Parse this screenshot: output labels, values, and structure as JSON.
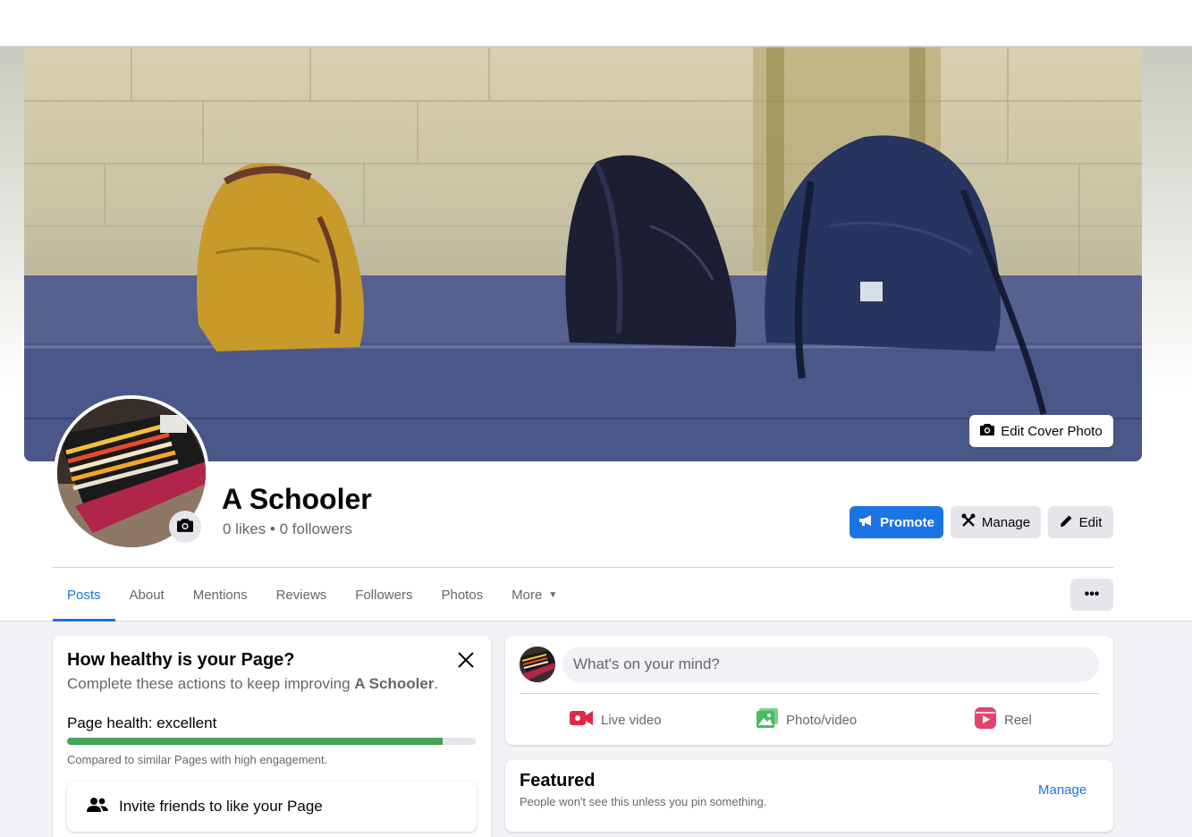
{
  "cover": {
    "edit_label": "Edit Cover Photo"
  },
  "page": {
    "name": "A Schooler",
    "stats": "0 likes • 0 followers"
  },
  "actions": {
    "promote": "Promote",
    "manage": "Manage",
    "edit": "Edit"
  },
  "tabs": [
    {
      "label": "Posts",
      "active": true
    },
    {
      "label": "About"
    },
    {
      "label": "Mentions"
    },
    {
      "label": "Reviews"
    },
    {
      "label": "Followers"
    },
    {
      "label": "Photos"
    },
    {
      "label": "More"
    }
  ],
  "more_options_label": "•••",
  "health": {
    "title": "How healthy is your Page?",
    "subtitle_prefix": "Complete these actions to keep improving",
    "subtitle_page": "A Schooler",
    "subtitle_suffix": ".",
    "status": "Page health: excellent",
    "progress": 0.92,
    "note": "Compared to similar Pages with high engagement.",
    "invite_label": "Invite friends to like your Page"
  },
  "composer": {
    "placeholder": "What's on your mind?",
    "live_video": "Live video",
    "photo_video": "Photo/video",
    "reel": "Reel"
  },
  "featured": {
    "title": "Featured",
    "subtitle": "People won't see this unless you pin something.",
    "manage": "Manage"
  },
  "colors": {
    "accent": "#1b74e4",
    "health_bar": "#45a35a",
    "live": "#e42645",
    "photo": "#45bd62",
    "reel": "#e2446e"
  }
}
